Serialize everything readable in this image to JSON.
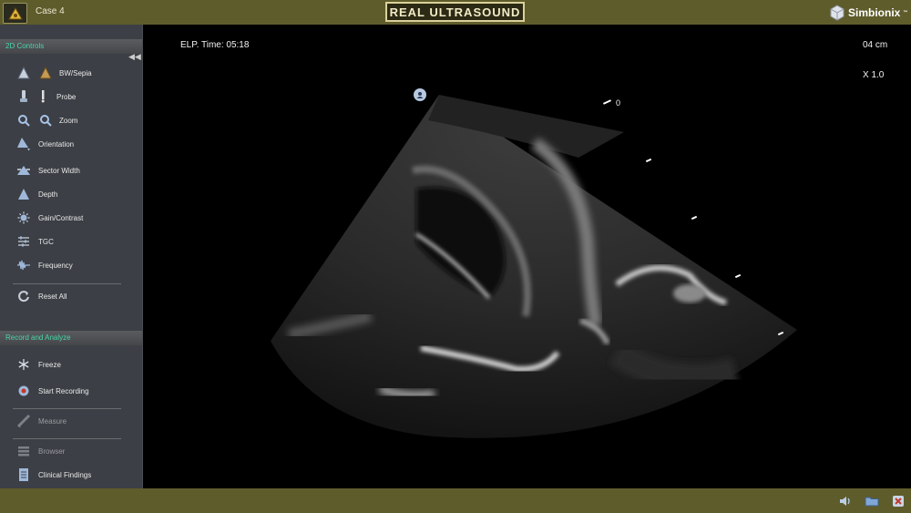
{
  "header": {
    "case_title": "Case 4",
    "brand": "REAL ULTRASOUND",
    "vendor": "Simbionix",
    "vendor_tm": "™"
  },
  "sidebar": {
    "controls_header": "2D Controls",
    "record_header": "Record and Analyze",
    "controls": [
      {
        "label": "BW/Sepia",
        "icon": "bw-sepia-icon"
      },
      {
        "label": "Probe",
        "icon": "probe-icon"
      },
      {
        "label": "Zoom",
        "icon": "zoom-icon"
      },
      {
        "label": "Orientation",
        "icon": "orientation-icon"
      },
      {
        "label": "Sector Width",
        "icon": "sector-width-icon"
      },
      {
        "label": "Depth",
        "icon": "depth-icon"
      },
      {
        "label": "Gain/Contrast",
        "icon": "gain-contrast-icon"
      },
      {
        "label": "TGC",
        "icon": "tgc-icon"
      },
      {
        "label": "Frequency",
        "icon": "frequency-icon"
      },
      {
        "label": "Reset All",
        "icon": "reset-icon"
      }
    ],
    "record": [
      {
        "label": "Freeze",
        "icon": "freeze-icon"
      },
      {
        "label": "Start Recording",
        "icon": "record-icon"
      },
      {
        "label": "Measure",
        "icon": "measure-icon",
        "disabled": true
      },
      {
        "label": "Browser",
        "icon": "browser-icon",
        "disabled": true
      },
      {
        "label": "Clinical Findings",
        "icon": "clinical-findings-icon"
      }
    ]
  },
  "viewer": {
    "elapsed_time": "ELP. Time: 05:18",
    "depth": "04 cm",
    "zoom": "X 1.0",
    "scale_zero": "0"
  },
  "footer": {
    "buttons": [
      "volume-icon",
      "folder-icon",
      "close-icon"
    ]
  },
  "colors": {
    "bar": "#5f5c2c",
    "sidebar": "#3c3f45",
    "accent": "#49d8a6"
  }
}
